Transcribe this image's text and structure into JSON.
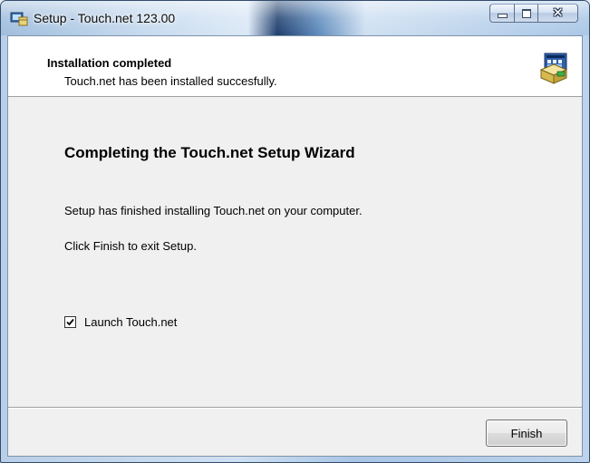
{
  "window": {
    "title": "Setup - Touch.net 123.00",
    "app_icon": "setup-installer-icon",
    "caption_buttons": {
      "minimize_icon": "minimize-icon",
      "maximize_icon": "maximize-icon",
      "close_icon": "close-icon",
      "close_glyph": "✕"
    }
  },
  "header": {
    "title": "Installation completed",
    "subtitle": "Touch.net has been installed succesfully.",
    "icon": "installer-box-icon"
  },
  "body": {
    "heading": "Completing the Touch.net Setup Wizard",
    "line1": "Setup has finished installing Touch.net on your computer.",
    "line2": "Click Finish to exit Setup.",
    "launch_checkbox": {
      "label": "Launch Touch.net",
      "checked": true
    }
  },
  "footer": {
    "finish_label": "Finish"
  },
  "colors": {
    "dialog_background": "#f0f0f0",
    "header_background": "#ffffff",
    "titlebar_accent": "#1f3f6e"
  }
}
